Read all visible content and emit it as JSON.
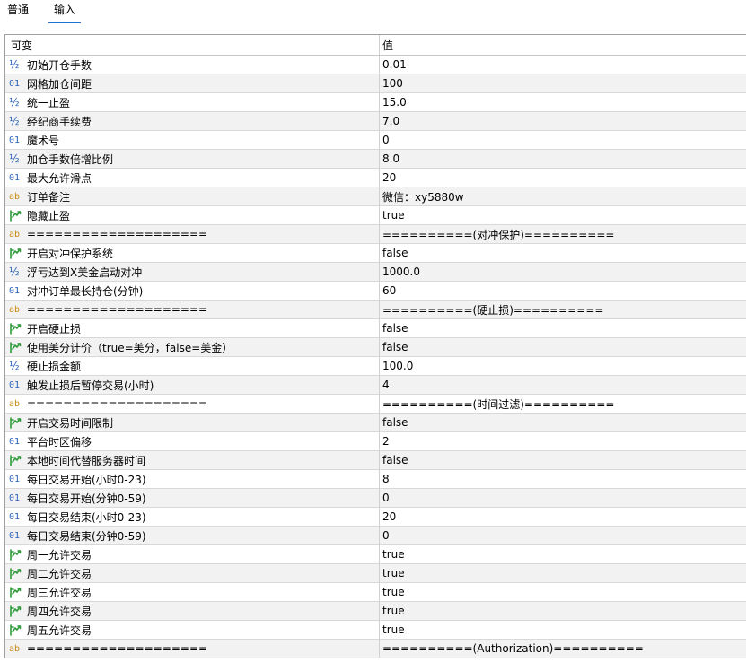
{
  "tabs": [
    {
      "label": "普通",
      "active": false
    },
    {
      "label": "输入",
      "active": true
    }
  ],
  "table": {
    "header": {
      "variable": "可变",
      "value": "值"
    },
    "rows": [
      {
        "type": "double",
        "name": "初始开仓手数",
        "value": "0.01"
      },
      {
        "type": "int",
        "name": "网格加仓间距",
        "value": "100"
      },
      {
        "type": "double",
        "name": "统一止盈",
        "value": "15.0"
      },
      {
        "type": "double",
        "name": "经纪商手续费",
        "value": "7.0"
      },
      {
        "type": "int",
        "name": "魔术号",
        "value": "0"
      },
      {
        "type": "double",
        "name": "加仓手数倍增比例",
        "value": "8.0"
      },
      {
        "type": "int",
        "name": "最大允许滑点",
        "value": "20"
      },
      {
        "type": "string",
        "name": "订单备注",
        "value": "微信：xy5880w"
      },
      {
        "type": "bool",
        "name": "隐藏止盈",
        "value": "true"
      },
      {
        "type": "string",
        "name": "====================",
        "value": "==========(对冲保护)=========="
      },
      {
        "type": "bool",
        "name": "开启对冲保护系统",
        "value": "false"
      },
      {
        "type": "double",
        "name": "浮亏达到X美金启动对冲",
        "value": "1000.0"
      },
      {
        "type": "int",
        "name": "对冲订单最长持仓(分钟)",
        "value": "60"
      },
      {
        "type": "string",
        "name": "====================",
        "value": "==========(硬止损)=========="
      },
      {
        "type": "bool",
        "name": "开启硬止损",
        "value": "false"
      },
      {
        "type": "bool",
        "name": "使用美分计价（true=美分，false=美金）",
        "value": "false"
      },
      {
        "type": "double",
        "name": "硬止损金额",
        "value": "100.0"
      },
      {
        "type": "int",
        "name": "触发止损后暂停交易(小时)",
        "value": "4"
      },
      {
        "type": "string",
        "name": "====================",
        "value": "==========(时间过滤)=========="
      },
      {
        "type": "bool",
        "name": "开启交易时间限制",
        "value": "false"
      },
      {
        "type": "int",
        "name": "平台时区偏移",
        "value": "2"
      },
      {
        "type": "bool",
        "name": "本地时间代替服务器时间",
        "value": "false"
      },
      {
        "type": "int",
        "name": "每日交易开始(小时0-23)",
        "value": "8"
      },
      {
        "type": "int",
        "name": "每日交易开始(分钟0-59)",
        "value": "0"
      },
      {
        "type": "int",
        "name": "每日交易结束(小时0-23)",
        "value": "20"
      },
      {
        "type": "int",
        "name": "每日交易结束(分钟0-59)",
        "value": "0"
      },
      {
        "type": "bool",
        "name": "周一允许交易",
        "value": "true"
      },
      {
        "type": "bool",
        "name": "周二允许交易",
        "value": "true"
      },
      {
        "type": "bool",
        "name": "周三允许交易",
        "value": "true"
      },
      {
        "type": "bool",
        "name": "周四允许交易",
        "value": "true"
      },
      {
        "type": "bool",
        "name": "周五允许交易",
        "value": "true"
      },
      {
        "type": "string",
        "name": "====================",
        "value": "==========(Authorization)=========="
      }
    ]
  },
  "icons": {
    "int": {
      "glyph": "01",
      "name": "integer-type-icon"
    },
    "double": {
      "glyph": "½",
      "name": "double-type-icon"
    },
    "string": {
      "glyph": "ab",
      "name": "string-type-icon"
    },
    "bool": {
      "glyph": "",
      "name": "bool-type-icon"
    }
  },
  "colors": {
    "accent": "#1f6fd1",
    "type_icon_blue": "#2a62b8",
    "type_icon_orange": "#c98a12",
    "bool_icon_green": "#2e9a3a",
    "alt_row": "#f2f2f2"
  }
}
